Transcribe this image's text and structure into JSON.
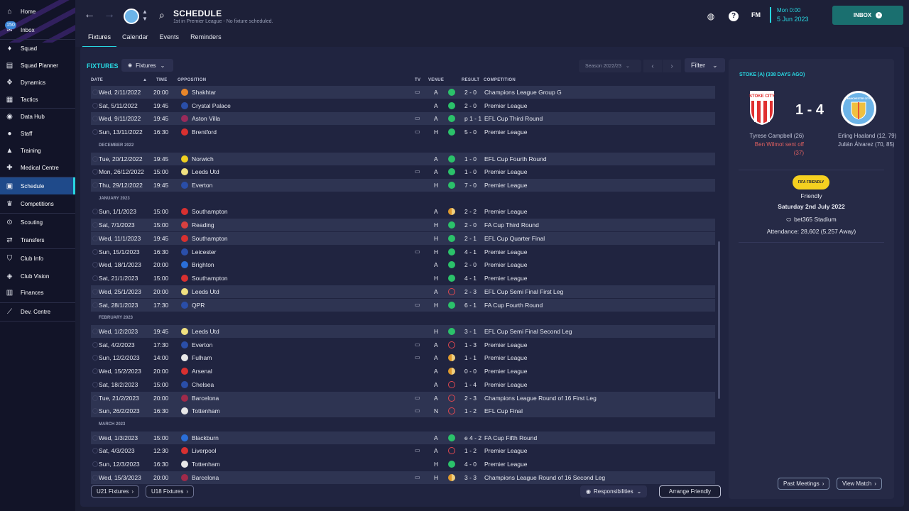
{
  "sidebar": {
    "items": [
      {
        "label": "Home",
        "icon": "home-icon",
        "glyph": "⌂"
      },
      {
        "label": "Inbox",
        "icon": "inbox-icon",
        "glyph": "✉",
        "badge": "150"
      },
      {
        "label": "Squad",
        "icon": "shirt-icon",
        "glyph": "♦"
      },
      {
        "label": "Squad Planner",
        "icon": "clipboard-icon",
        "glyph": "▤"
      },
      {
        "label": "Dynamics",
        "icon": "dynamics-icon",
        "glyph": "❖"
      },
      {
        "label": "Tactics",
        "icon": "tactics-board-icon",
        "glyph": "▦"
      },
      {
        "label": "Data Hub",
        "icon": "data-hub-icon",
        "glyph": "◉"
      },
      {
        "label": "Staff",
        "icon": "staff-icon",
        "glyph": "●"
      },
      {
        "label": "Training",
        "icon": "training-icon",
        "glyph": "▲"
      },
      {
        "label": "Medical Centre",
        "icon": "medical-icon",
        "glyph": "✚"
      },
      {
        "label": "Schedule",
        "icon": "calendar-icon",
        "glyph": "▣",
        "active": true
      },
      {
        "label": "Competitions",
        "icon": "trophy-icon",
        "glyph": "♛"
      },
      {
        "label": "Scouting",
        "icon": "scouting-icon",
        "glyph": "⊙"
      },
      {
        "label": "Transfers",
        "icon": "transfers-icon",
        "glyph": "⇄"
      },
      {
        "label": "Club Info",
        "icon": "shield-icon",
        "glyph": "⛉"
      },
      {
        "label": "Club Vision",
        "icon": "vision-icon",
        "glyph": "◈"
      },
      {
        "label": "Finances",
        "icon": "finances-icon",
        "glyph": "▥"
      },
      {
        "label": "Dev. Centre",
        "icon": "dev-centre-icon",
        "glyph": "⟋"
      }
    ]
  },
  "header": {
    "title": "SCHEDULE",
    "subtitle": "1st in Premier League - No fixture scheduled.",
    "tabs": [
      "Fixtures",
      "Calendar",
      "Events",
      "Reminders"
    ],
    "fm": "FM",
    "date_line1": "Mon 0:00",
    "date_line2": "5 Jun 2023",
    "inbox": "INBOX"
  },
  "fixtures_view": {
    "title": "FIXTURES",
    "dropdown": "Fixtures",
    "season": "Season 2022/23",
    "filter": "Filter",
    "columns": {
      "date": "DATE",
      "time": "TIME",
      "opposition": "OPPOSITION",
      "tv": "TV",
      "venue": "VENUE",
      "result": "RESULT",
      "competition": "COMPETITION"
    }
  },
  "fixtures": [
    {
      "date": "Wed, 2/11/2022",
      "time": "20:00",
      "opp": "Shakhtar",
      "tv": true,
      "venue": "A",
      "outcome": "win",
      "result": "2 - 0",
      "comp": "Champions League Group G",
      "hl": true,
      "crest": "#e8862a"
    },
    {
      "date": "Sat, 5/11/2022",
      "time": "19:45",
      "opp": "Crystal Palace",
      "tv": false,
      "venue": "A",
      "outcome": "win",
      "result": "2 - 0",
      "comp": "Premier League",
      "hl": false,
      "crest": "#2a4ea8"
    },
    {
      "date": "Wed, 9/11/2022",
      "time": "19:45",
      "opp": "Aston Villa",
      "tv": true,
      "venue": "A",
      "outcome": "win",
      "result": "p 1 - 1",
      "comp": "EFL Cup Third Round",
      "hl": true,
      "crest": "#9a2a5a"
    },
    {
      "date": "Sun, 13/11/2022",
      "time": "16:30",
      "opp": "Brentford",
      "tv": true,
      "venue": "H",
      "outcome": "win",
      "result": "5 - 0",
      "comp": "Premier League",
      "hl": false,
      "crest": "#d83030"
    },
    {
      "month": "DECEMBER 2022"
    },
    {
      "date": "Tue, 20/12/2022",
      "time": "19:45",
      "opp": "Norwich",
      "tv": false,
      "venue": "A",
      "outcome": "win",
      "result": "1 - 0",
      "comp": "EFL Cup Fourth Round",
      "hl": true,
      "crest": "#f0d020"
    },
    {
      "date": "Mon, 26/12/2022",
      "time": "15:00",
      "opp": "Leeds Utd",
      "tv": true,
      "venue": "A",
      "outcome": "win",
      "result": "1 - 0",
      "comp": "Premier League",
      "hl": false,
      "crest": "#f0e080"
    },
    {
      "date": "Thu, 29/12/2022",
      "time": "19:45",
      "opp": "Everton",
      "tv": false,
      "venue": "H",
      "outcome": "win",
      "result": "7 - 0",
      "comp": "Premier League",
      "hl": true,
      "crest": "#2a4ea8"
    },
    {
      "month": "JANUARY 2023"
    },
    {
      "date": "Sun, 1/1/2023",
      "time": "15:00",
      "opp": "Southampton",
      "tv": false,
      "venue": "A",
      "outcome": "draw",
      "result": "2 - 2",
      "comp": "Premier League",
      "hl": false,
      "crest": "#d83030"
    },
    {
      "date": "Sat, 7/1/2023",
      "time": "15:00",
      "opp": "Reading",
      "tv": false,
      "venue": "H",
      "outcome": "win",
      "result": "2 - 0",
      "comp": "FA Cup Third Round",
      "hl": true,
      "crest": "#d84040"
    },
    {
      "date": "Wed, 11/1/2023",
      "time": "19:45",
      "opp": "Southampton",
      "tv": false,
      "venue": "H",
      "outcome": "win",
      "result": "2 - 1",
      "comp": "EFL Cup Quarter Final",
      "hl": true,
      "crest": "#d83030"
    },
    {
      "date": "Sun, 15/1/2023",
      "time": "16:30",
      "opp": "Leicester",
      "tv": true,
      "venue": "H",
      "outcome": "win",
      "result": "4 - 1",
      "comp": "Premier League",
      "hl": false,
      "crest": "#2a4ea8"
    },
    {
      "date": "Wed, 18/1/2023",
      "time": "20:00",
      "opp": "Brighton",
      "tv": false,
      "venue": "A",
      "outcome": "win",
      "result": "2 - 0",
      "comp": "Premier League",
      "hl": false,
      "crest": "#2a6ed8"
    },
    {
      "date": "Sat, 21/1/2023",
      "time": "15:00",
      "opp": "Southampton",
      "tv": false,
      "venue": "H",
      "outcome": "win",
      "result": "4 - 1",
      "comp": "Premier League",
      "hl": false,
      "crest": "#d83030"
    },
    {
      "date": "Wed, 25/1/2023",
      "time": "20:00",
      "opp": "Leeds Utd",
      "tv": false,
      "venue": "A",
      "outcome": "loss",
      "result": "2 - 3",
      "comp": "EFL Cup Semi Final First Leg",
      "hl": true,
      "crest": "#f0e080"
    },
    {
      "date": "Sat, 28/1/2023",
      "time": "17:30",
      "opp": "QPR",
      "tv": true,
      "venue": "H",
      "outcome": "win",
      "result": "6 - 1",
      "comp": "FA Cup Fourth Round",
      "hl": true,
      "crest": "#2a4ea8"
    },
    {
      "month": "FEBRUARY 2023"
    },
    {
      "date": "Wed, 1/2/2023",
      "time": "19:45",
      "opp": "Leeds Utd",
      "tv": false,
      "venue": "H",
      "outcome": "win",
      "result": "3 - 1",
      "comp": "EFL Cup Semi Final Second Leg",
      "hl": true,
      "crest": "#f0e080"
    },
    {
      "date": "Sat, 4/2/2023",
      "time": "17:30",
      "opp": "Everton",
      "tv": true,
      "venue": "A",
      "outcome": "loss",
      "result": "1 - 3",
      "comp": "Premier League",
      "hl": false,
      "crest": "#2a4ea8"
    },
    {
      "date": "Sun, 12/2/2023",
      "time": "14:00",
      "opp": "Fulham",
      "tv": true,
      "venue": "A",
      "outcome": "draw",
      "result": "1 - 1",
      "comp": "Premier League",
      "hl": false,
      "crest": "#e8e8e8"
    },
    {
      "date": "Wed, 15/2/2023",
      "time": "20:00",
      "opp": "Arsenal",
      "tv": false,
      "venue": "A",
      "outcome": "draw",
      "result": "0 - 0",
      "comp": "Premier League",
      "hl": false,
      "crest": "#d83030"
    },
    {
      "date": "Sat, 18/2/2023",
      "time": "15:00",
      "opp": "Chelsea",
      "tv": false,
      "venue": "A",
      "outcome": "loss",
      "result": "1 - 4",
      "comp": "Premier League",
      "hl": false,
      "crest": "#2a4ea8"
    },
    {
      "date": "Tue, 21/2/2023",
      "time": "20:00",
      "opp": "Barcelona",
      "tv": true,
      "venue": "A",
      "outcome": "loss",
      "result": "2 - 3",
      "comp": "Champions League Round of 16  First Leg",
      "hl": true,
      "crest": "#a02a4a"
    },
    {
      "date": "Sun, 26/2/2023",
      "time": "16:30",
      "opp": "Tottenham",
      "tv": true,
      "venue": "N",
      "outcome": "loss",
      "result": "1 - 2",
      "comp": "EFL Cup Final",
      "hl": true,
      "crest": "#e8e8e8"
    },
    {
      "month": "MARCH 2023"
    },
    {
      "date": "Wed, 1/3/2023",
      "time": "15:00",
      "opp": "Blackburn",
      "tv": false,
      "venue": "A",
      "outcome": "win",
      "result": "e 4 - 2",
      "comp": "FA Cup Fifth Round",
      "hl": true,
      "crest": "#2a6ed8"
    },
    {
      "date": "Sat, 4/3/2023",
      "time": "12:30",
      "opp": "Liverpool",
      "tv": true,
      "venue": "A",
      "outcome": "loss",
      "result": "1 - 2",
      "comp": "Premier League",
      "hl": false,
      "crest": "#d83030"
    },
    {
      "date": "Sun, 12/3/2023",
      "time": "16:30",
      "opp": "Tottenham",
      "tv": false,
      "venue": "H",
      "outcome": "win",
      "result": "4 - 0",
      "comp": "Premier League",
      "hl": false,
      "crest": "#e8e8e8"
    },
    {
      "date": "Wed, 15/3/2023",
      "time": "20:00",
      "opp": "Barcelona",
      "tv": true,
      "venue": "H",
      "outcome": "draw",
      "result": "3 - 3",
      "comp": "Champions League Round of 16  Second Leg",
      "hl": true,
      "crest": "#a02a4a"
    }
  ],
  "bottom": {
    "u21": "U21 Fixtures",
    "u18": "U18 Fixtures",
    "responsibilities": "Responsibilities",
    "arrange": "Arrange Friendly",
    "past": "Past Meetings",
    "view": "View Match"
  },
  "match": {
    "title": "STOKE (A) (338 DAYS AGO)",
    "stoke_crest_text": "STOKE CITY",
    "city_crest_text": "MANCHESTER CITY",
    "score": "1 - 4",
    "home_scorer": "Tyrese Campbell (26)",
    "home_red_line1": "Ben Wilmot sent off",
    "home_red_line2": "(37)",
    "away_scorer1": "Erling Haaland (12, 79)",
    "away_scorer2": "Julián Álvarez (70, 85)",
    "fifa_badge": "FIFA FRIENDLY",
    "competition": "Friendly",
    "date": "Saturday 2nd July 2022",
    "stadium": "bet365 Stadium",
    "attendance": "Attendance: 28,602 (5,257 Away)"
  }
}
